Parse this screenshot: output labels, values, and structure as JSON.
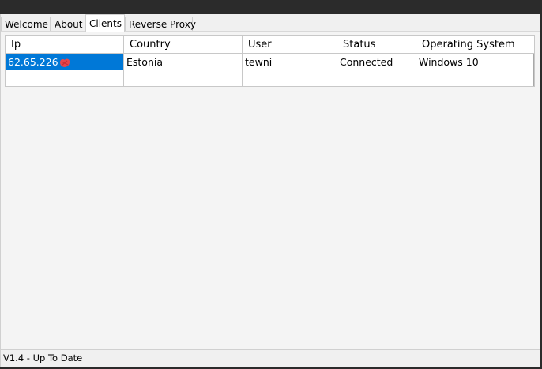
{
  "tabs": [
    {
      "label": "Welcome",
      "active": false
    },
    {
      "label": "About",
      "active": false
    },
    {
      "label": "Clients",
      "active": true
    },
    {
      "label": "Reverse Proxy",
      "active": false
    }
  ],
  "clients_table": {
    "columns": [
      "Ip",
      "Country",
      "User",
      "Status",
      "Operating System"
    ],
    "rows": [
      {
        "ip": "62.65.226",
        "country": "Estonia",
        "user": "tewni",
        "status": "Connected",
        "os": "Windows 10",
        "selected": true
      }
    ]
  },
  "status_bar": {
    "text": "V1.4 - Up To Date"
  },
  "colors": {
    "selection": "#0078d7",
    "titlebar": "#2b2b2b",
    "redaction": "#e8454a"
  }
}
